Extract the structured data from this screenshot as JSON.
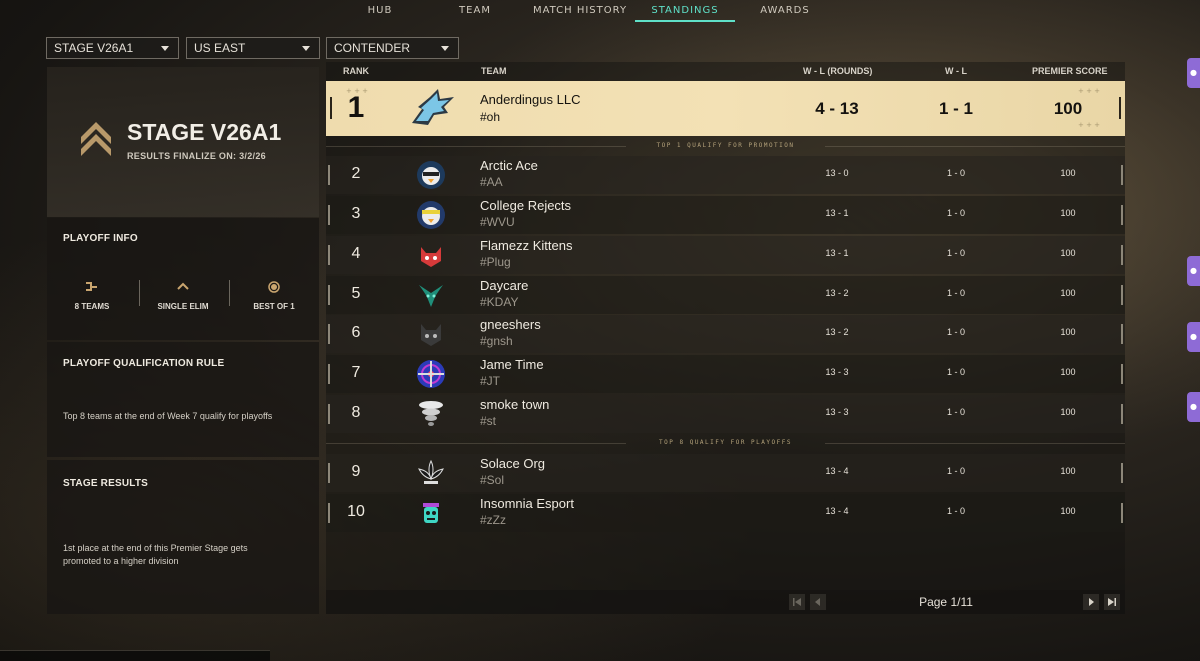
{
  "nav": {
    "tabs": [
      {
        "label": "HUB"
      },
      {
        "label": "TEAM"
      },
      {
        "label": "MATCH HISTORY"
      },
      {
        "label": "STANDINGS"
      },
      {
        "label": "AWARDS"
      }
    ],
    "active": "STANDINGS"
  },
  "filters": {
    "stage": "STAGE V26A1",
    "region": "US EAST",
    "division": "CONTENDER"
  },
  "stage": {
    "title": "STAGE V26A1",
    "finalize": "RESULTS FINALIZE ON: 3/2/26"
  },
  "playoff_info": {
    "heading": "PLAYOFF INFO",
    "teams": "8 TEAMS",
    "format": "SINGLE ELIM",
    "series": "BEST OF 1"
  },
  "qualification": {
    "heading": "PLAYOFF QUALIFICATION RULE",
    "text": "Top 8 teams at the end of Week 7 qualify for playoffs"
  },
  "stage_results": {
    "heading": "STAGE RESULTS",
    "text": "1st place at the end of this Premier Stage gets promoted to a higher division"
  },
  "table": {
    "headers": {
      "rank": "RANK",
      "team": "TEAM",
      "wl_rounds": "W - L (ROUNDS)",
      "wl": "W - L",
      "score": "PREMIER SCORE"
    },
    "top": {
      "rank": "1",
      "name": "Anderdingus LLC",
      "tag": "#oh",
      "wl_rounds": "4 - 13",
      "wl": "1 - 1",
      "score": "100"
    },
    "promotion_label": "TOP 1 QUALIFY FOR PROMOTION",
    "playoff_label": "TOP 8 QUALIFY FOR PLAYOFFS",
    "rows": [
      {
        "rank": "2",
        "name": "Arctic Ace",
        "tag": "#AA",
        "wl_rounds": "13 - 0",
        "wl": "1 - 0",
        "score": "100"
      },
      {
        "rank": "3",
        "name": "College Rejects",
        "tag": "#WVU",
        "wl_rounds": "13 - 1",
        "wl": "1 - 0",
        "score": "100"
      },
      {
        "rank": "4",
        "name": "Flamezz Kittens",
        "tag": "#Plug",
        "wl_rounds": "13 - 1",
        "wl": "1 - 0",
        "score": "100"
      },
      {
        "rank": "5",
        "name": "Daycare",
        "tag": "#KDAY",
        "wl_rounds": "13 - 2",
        "wl": "1 - 0",
        "score": "100"
      },
      {
        "rank": "6",
        "name": "gneeshers",
        "tag": "#gnsh",
        "wl_rounds": "13 - 2",
        "wl": "1 - 0",
        "score": "100"
      },
      {
        "rank": "7",
        "name": "Jame Time",
        "tag": "#JT",
        "wl_rounds": "13 - 3",
        "wl": "1 - 0",
        "score": "100"
      },
      {
        "rank": "8",
        "name": "smoke town",
        "tag": "#st",
        "wl_rounds": "13 - 3",
        "wl": "1 - 0",
        "score": "100"
      },
      {
        "rank": "9",
        "name": "Solace Org",
        "tag": "#Sol",
        "wl_rounds": "13 - 4",
        "wl": "1 - 0",
        "score": "100"
      },
      {
        "rank": "10",
        "name": "Insomnia Esport",
        "tag": "#zZz",
        "wl_rounds": "13 - 4",
        "wl": "1 - 0",
        "score": "100"
      }
    ]
  },
  "pager": {
    "label": "Page 1/11"
  },
  "colors": {
    "accent": "#5fe0c8",
    "highlight_row": "#efdcae",
    "side_tab": "#8e6bd6"
  }
}
